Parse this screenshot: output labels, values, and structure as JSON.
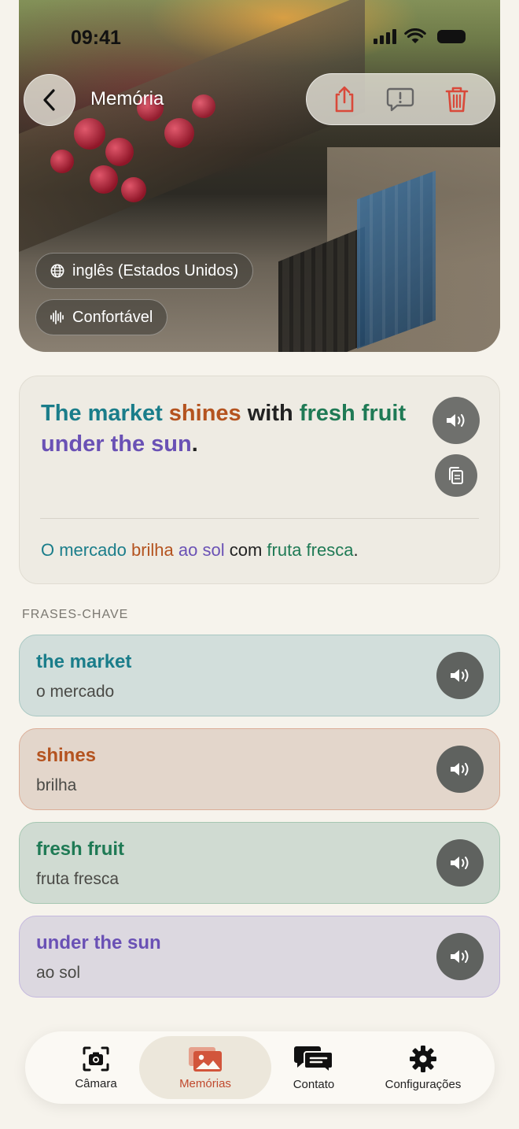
{
  "status_bar": {
    "time": "09:41"
  },
  "header": {
    "title": "Memória"
  },
  "chips": {
    "language": "inglês (Estados Unidos)",
    "speed": "Confortável"
  },
  "sentence": {
    "parts": [
      {
        "text": "The market",
        "color": "#1a7d8a"
      },
      {
        "text": " "
      },
      {
        "text": "shines",
        "color": "#b4531f"
      },
      {
        "text": " with "
      },
      {
        "text": "fresh fruit",
        "color": "#1f7a55"
      },
      {
        "text": " "
      },
      {
        "text": "under the sun",
        "color": "#6a51b5"
      },
      {
        "text": "."
      }
    ],
    "translation_parts": [
      {
        "text": "O mercado",
        "color": "#1a7d8a"
      },
      {
        "text": " "
      },
      {
        "text": "brilha",
        "color": "#b4531f"
      },
      {
        "text": " "
      },
      {
        "text": "ao sol",
        "color": "#6a51b5"
      },
      {
        "text": " com "
      },
      {
        "text": "fruta fresca",
        "color": "#1f7a55"
      },
      {
        "text": "."
      }
    ]
  },
  "key_phrases": {
    "label": "FRASES-CHAVE",
    "items": [
      {
        "phrase": "the market",
        "translation": "o mercado"
      },
      {
        "phrase": "shines",
        "translation": "brilha"
      },
      {
        "phrase": "fresh fruit",
        "translation": "fruta fresca"
      },
      {
        "phrase": "under the sun",
        "translation": "ao sol"
      }
    ]
  },
  "tabbar": {
    "camera": "Câmara",
    "memories": "Memórias",
    "contact": "Contato",
    "settings": "Configurações"
  },
  "colors": {
    "accent": "#c0492e",
    "background": "#f6f3ec"
  }
}
